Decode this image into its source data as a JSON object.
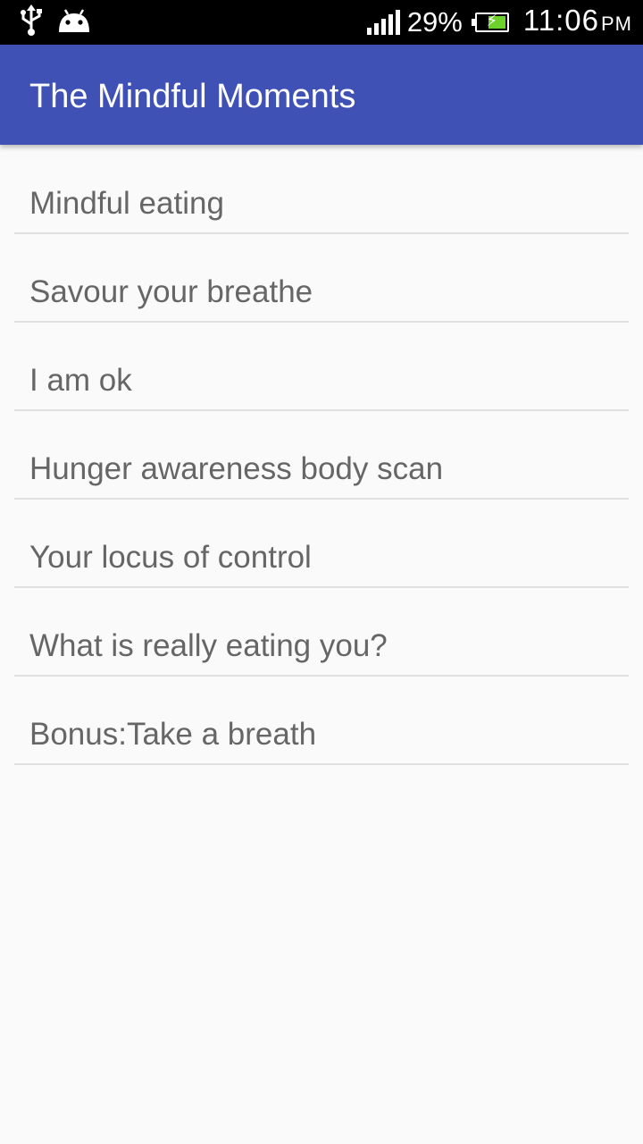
{
  "status_bar": {
    "left_icons": [
      "usb-icon",
      "android-debug-icon"
    ],
    "signal_icon": "signal-strength-icon",
    "battery_percent": "29%",
    "battery_icon": "battery-charging-icon",
    "battery_level": 0.29,
    "time": "11:06",
    "ampm": "PM"
  },
  "app_bar": {
    "title": "The Mindful Moments",
    "color": "#3f51b5"
  },
  "list": {
    "items": [
      {
        "label": "Mindful eating"
      },
      {
        "label": "Savour your breathe"
      },
      {
        "label": "I am ok"
      },
      {
        "label": "Hunger awareness body scan"
      },
      {
        "label": "Your locus of control"
      },
      {
        "label": "What is really eating you?"
      },
      {
        "label": "Bonus:Take a breath"
      }
    ]
  }
}
